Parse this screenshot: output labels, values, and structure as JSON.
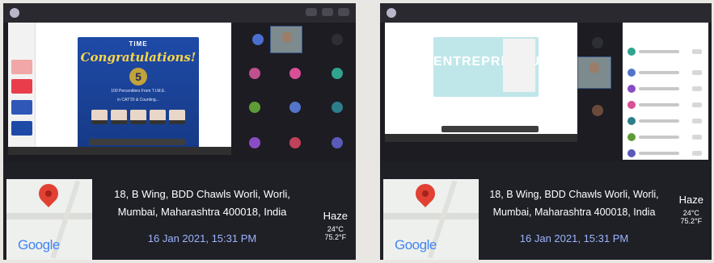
{
  "left": {
    "slide": {
      "brand": "TIME",
      "headline": "Congratulations!",
      "number": "5",
      "subtitle_1": "100 Percentilers From T.I.M.E.",
      "subtitle_2": "in CAT'20 & Counting..."
    },
    "address_line_1": "18, B Wing, BDD Chawls Worli, Worli,",
    "address_line_2": "Mumbai, Maharashtra 400018, India",
    "timestamp": "16 Jan 2021, 15:31 PM",
    "weather": {
      "condition": "Haze",
      "celsius": "24°C",
      "fahrenheit": "75.2°F"
    },
    "map_brand": "Google"
  },
  "right": {
    "slide": {
      "headline": "ENTREPRENEUR"
    },
    "address_line_1": "18, B Wing, BDD Chawls Worli, Worli,",
    "address_line_2": "Mumbai, Maharashtra 400018, India",
    "timestamp": "16 Jan 2021, 15:31 PM",
    "weather": {
      "condition": "Haze",
      "celsius": "24°C",
      "fahrenheit": "75.2°F"
    },
    "map_brand": "Google"
  },
  "colors": {
    "slide_blue": "#1e4aa7",
    "accent_yellow": "#f9d54a",
    "timestamp_blue": "#9db4ff",
    "end_call_red": "#d53a3a",
    "map_pin_red": "#e14133"
  },
  "icons": {
    "map_pin": "map-pin-icon",
    "mic": "microphone-icon",
    "camera": "camera-icon"
  }
}
